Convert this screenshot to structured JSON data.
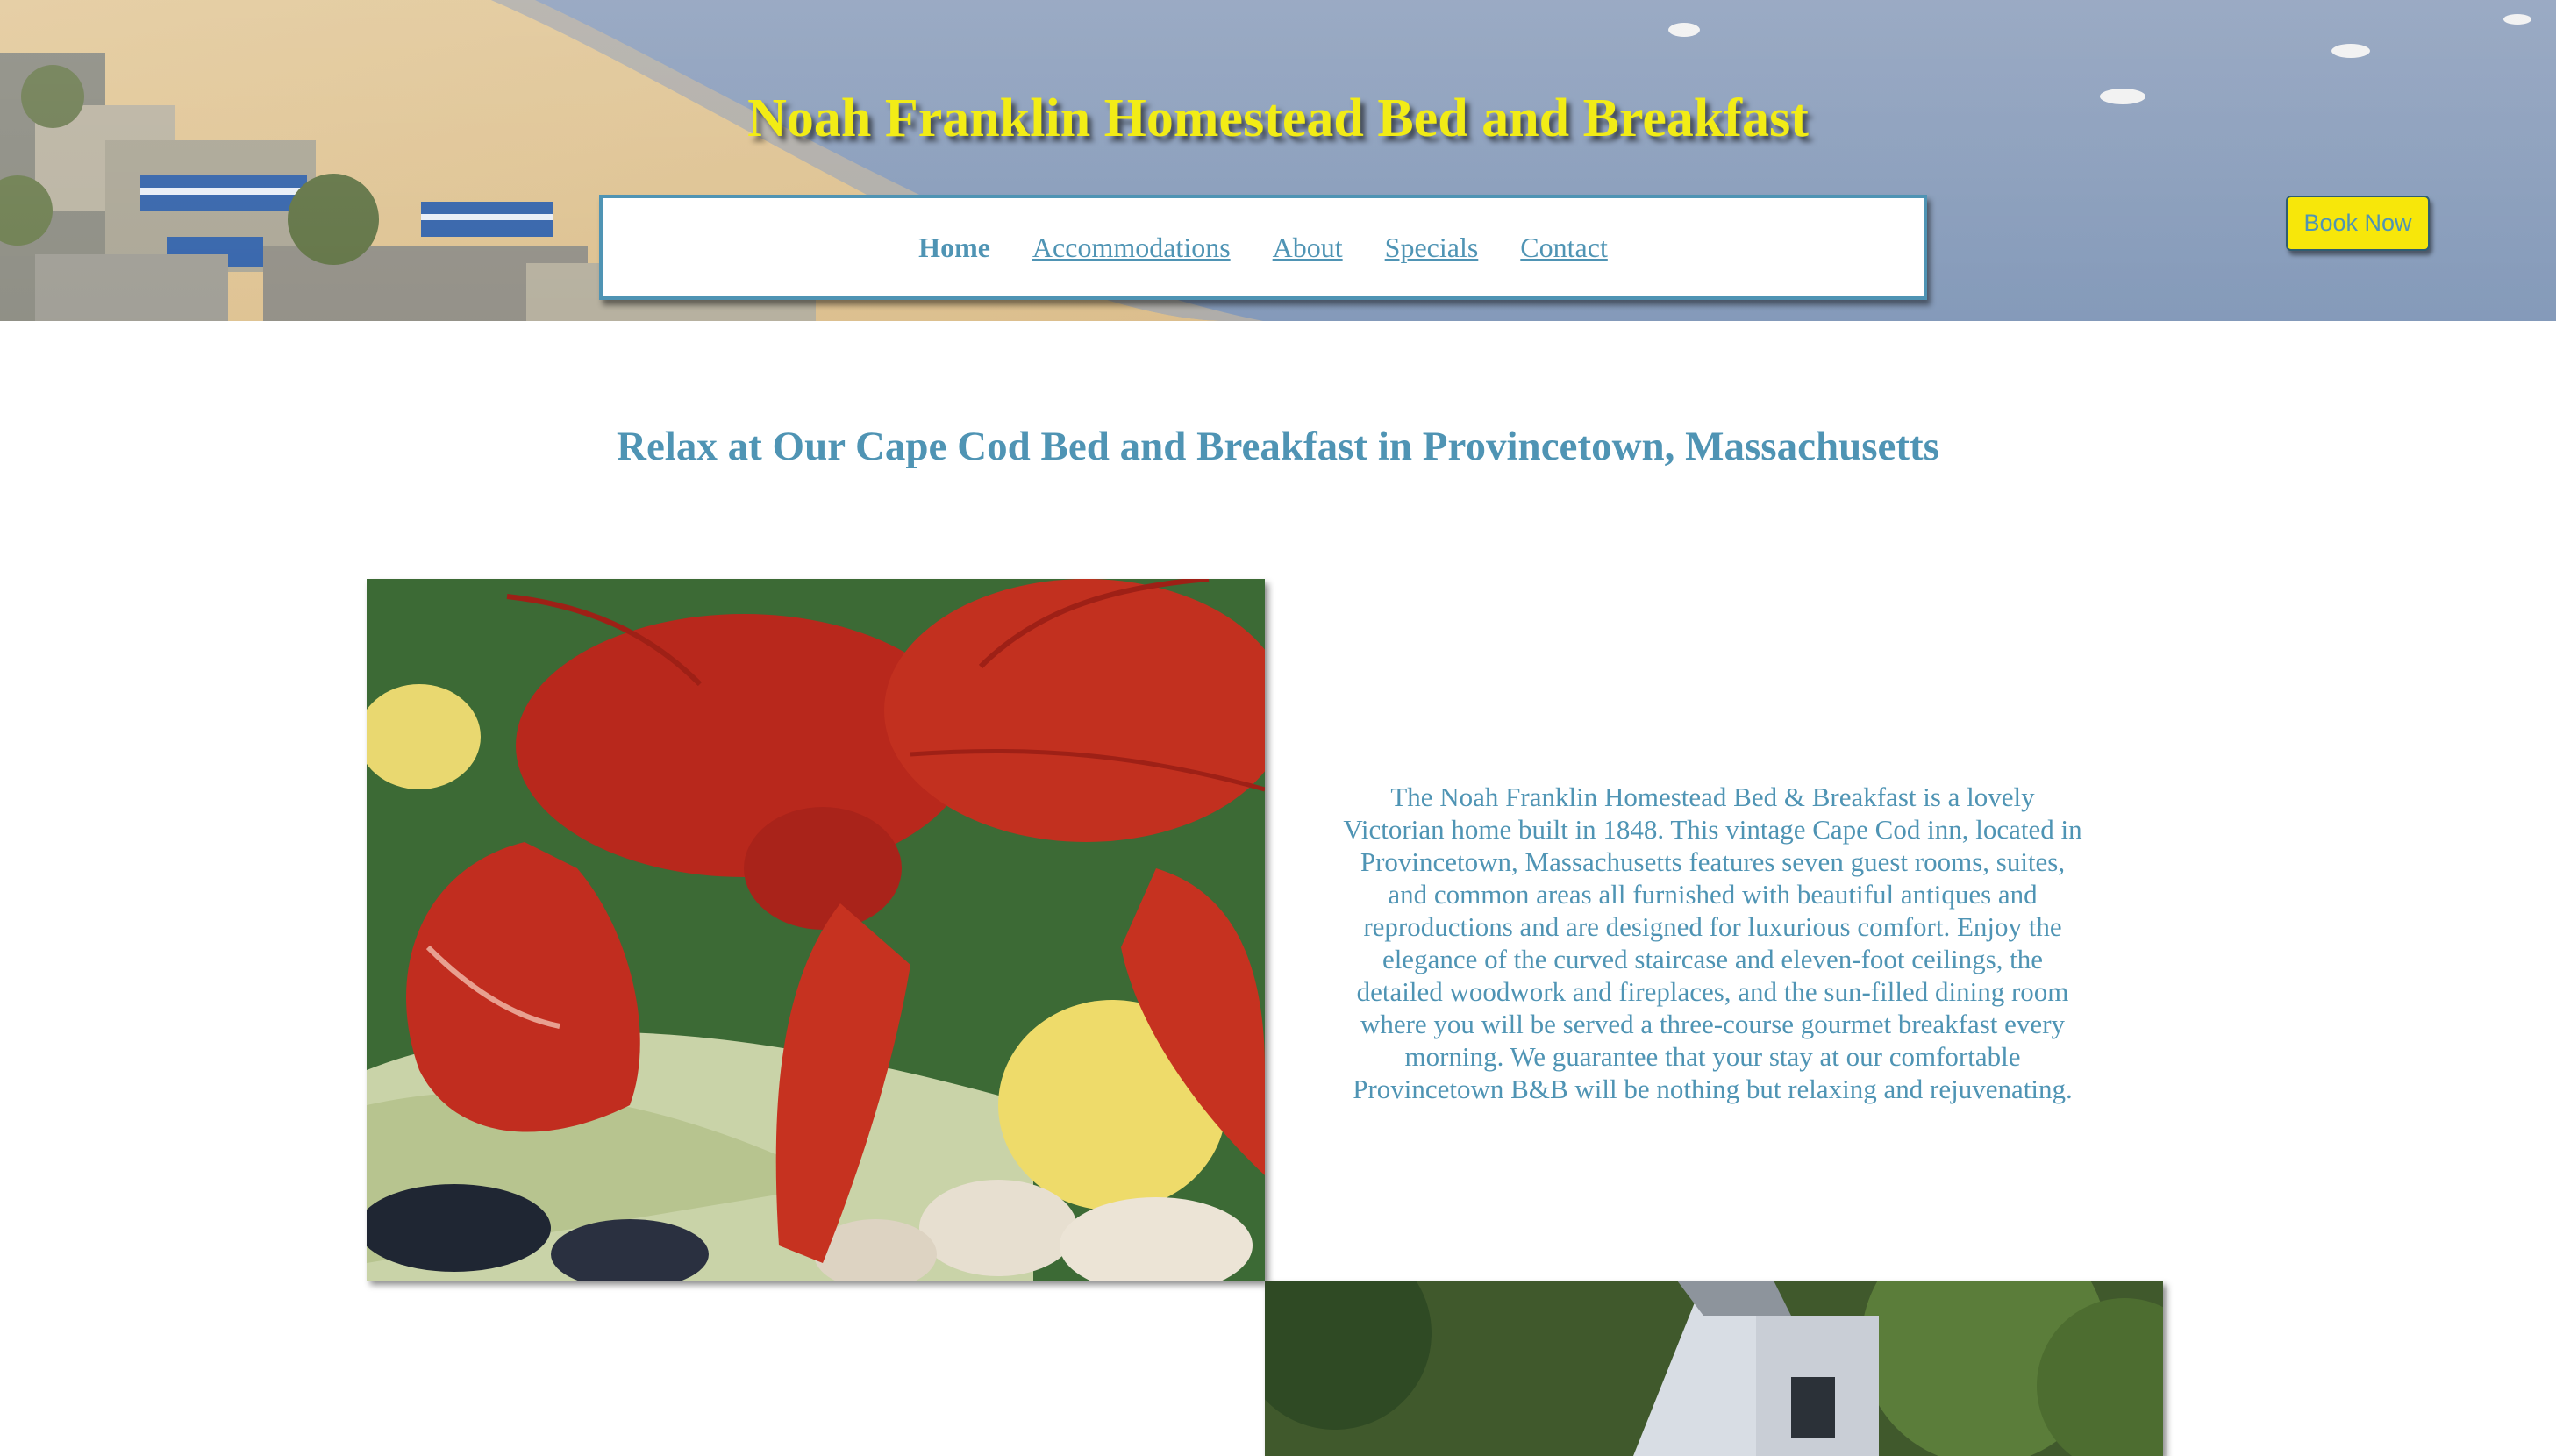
{
  "header": {
    "site_title": "Noah Franklin Homestead Bed and Breakfast",
    "book_now_label": "Book Now"
  },
  "nav": {
    "items": [
      {
        "label": "Home",
        "active": true
      },
      {
        "label": "Accommodations",
        "active": false
      },
      {
        "label": "About",
        "active": false
      },
      {
        "label": "Specials",
        "active": false
      },
      {
        "label": "Contact",
        "active": false
      }
    ]
  },
  "main": {
    "headline": "Relax at Our Cape Cod Bed and Breakfast in Provincetown, Massachusetts",
    "intro": "The Noah Franklin Homestead Bed & Breakfast is a lovely Victorian home built in 1848. This vintage Cape Cod inn, located in Provincetown, Massachusetts features seven guest rooms, suites, and common areas all furnished with beautiful antiques and reproductions and are designed for luxurious comfort. Enjoy the elegance of the curved staircase and eleven-foot ceilings, the detailed woodwork and fireplaces, and the sun-filled dining room where you will be served a three-course gourmet breakfast every morning. We guarantee that your stay at our comfortable Provincetown B&B will be nothing but relaxing and rejuvenating."
  },
  "colors": {
    "accent": "#4f94b4",
    "title_yellow": "#f2ec16",
    "button_yellow": "#f7e70a"
  }
}
